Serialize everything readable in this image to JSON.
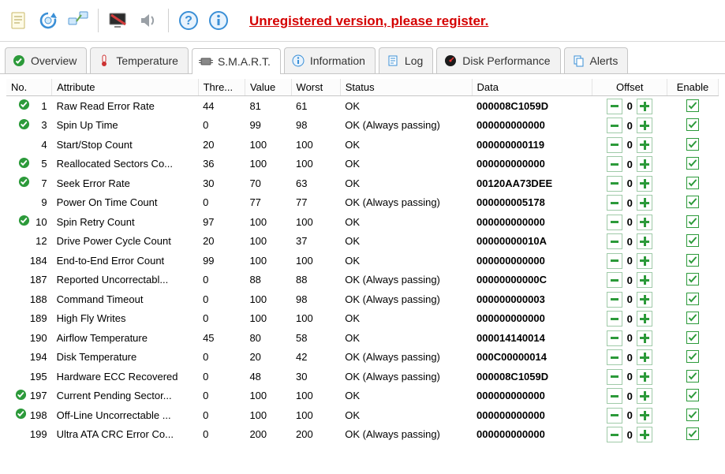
{
  "header": {
    "unregistered_text": "Unregistered version, please register."
  },
  "tabs": [
    {
      "label": "Overview"
    },
    {
      "label": "Temperature"
    },
    {
      "label": "S.M.A.R.T."
    },
    {
      "label": "Information"
    },
    {
      "label": "Log"
    },
    {
      "label": "Disk Performance"
    },
    {
      "label": "Alerts"
    }
  ],
  "columns": {
    "no": "No.",
    "attribute": "Attribute",
    "threshold": "Thre...",
    "value": "Value",
    "worst": "Worst",
    "status": "Status",
    "data": "Data",
    "offset": "Offset",
    "enable": "Enable"
  },
  "rows": [
    {
      "hasIcon": true,
      "no": "1",
      "attribute": "Raw Read Error Rate",
      "threshold": "44",
      "value": "81",
      "worst": "61",
      "status": "OK",
      "data": "000008C1059D",
      "offset": "0",
      "enable": true
    },
    {
      "hasIcon": true,
      "no": "3",
      "attribute": "Spin Up Time",
      "threshold": "0",
      "value": "99",
      "worst": "98",
      "status": "OK (Always passing)",
      "data": "000000000000",
      "offset": "0",
      "enable": true
    },
    {
      "hasIcon": false,
      "no": "4",
      "attribute": "Start/Stop Count",
      "threshold": "20",
      "value": "100",
      "worst": "100",
      "status": "OK",
      "data": "000000000119",
      "offset": "0",
      "enable": true
    },
    {
      "hasIcon": true,
      "no": "5",
      "attribute": "Reallocated Sectors Co...",
      "threshold": "36",
      "value": "100",
      "worst": "100",
      "status": "OK",
      "data": "000000000000",
      "offset": "0",
      "enable": true
    },
    {
      "hasIcon": true,
      "no": "7",
      "attribute": "Seek Error Rate",
      "threshold": "30",
      "value": "70",
      "worst": "63",
      "status": "OK",
      "data": "00120AA73DEE",
      "offset": "0",
      "enable": true
    },
    {
      "hasIcon": false,
      "no": "9",
      "attribute": "Power On Time Count",
      "threshold": "0",
      "value": "77",
      "worst": "77",
      "status": "OK (Always passing)",
      "data": "000000005178",
      "offset": "0",
      "enable": true
    },
    {
      "hasIcon": true,
      "no": "10",
      "attribute": "Spin Retry Count",
      "threshold": "97",
      "value": "100",
      "worst": "100",
      "status": "OK",
      "data": "000000000000",
      "offset": "0",
      "enable": true
    },
    {
      "hasIcon": false,
      "no": "12",
      "attribute": "Drive Power Cycle Count",
      "threshold": "20",
      "value": "100",
      "worst": "37",
      "status": "OK",
      "data": "00000000010A",
      "offset": "0",
      "enable": true
    },
    {
      "hasIcon": false,
      "no": "184",
      "attribute": "End-to-End Error Count",
      "threshold": "99",
      "value": "100",
      "worst": "100",
      "status": "OK",
      "data": "000000000000",
      "offset": "0",
      "enable": true
    },
    {
      "hasIcon": false,
      "no": "187",
      "attribute": "Reported Uncorrectabl...",
      "threshold": "0",
      "value": "88",
      "worst": "88",
      "status": "OK (Always passing)",
      "data": "00000000000C",
      "offset": "0",
      "enable": true
    },
    {
      "hasIcon": false,
      "no": "188",
      "attribute": "Command Timeout",
      "threshold": "0",
      "value": "100",
      "worst": "98",
      "status": "OK (Always passing)",
      "data": "000000000003",
      "offset": "0",
      "enable": true
    },
    {
      "hasIcon": false,
      "no": "189",
      "attribute": "High Fly Writes",
      "threshold": "0",
      "value": "100",
      "worst": "100",
      "status": "OK",
      "data": "000000000000",
      "offset": "0",
      "enable": true
    },
    {
      "hasIcon": false,
      "no": "190",
      "attribute": "Airflow Temperature",
      "threshold": "45",
      "value": "80",
      "worst": "58",
      "status": "OK",
      "data": "000014140014",
      "offset": "0",
      "enable": true
    },
    {
      "hasIcon": false,
      "no": "194",
      "attribute": "Disk Temperature",
      "threshold": "0",
      "value": "20",
      "worst": "42",
      "status": "OK (Always passing)",
      "data": "000C00000014",
      "offset": "0",
      "enable": true
    },
    {
      "hasIcon": false,
      "no": "195",
      "attribute": "Hardware ECC Recovered",
      "threshold": "0",
      "value": "48",
      "worst": "30",
      "status": "OK (Always passing)",
      "data": "000008C1059D",
      "offset": "0",
      "enable": true
    },
    {
      "hasIcon": true,
      "no": "197",
      "attribute": "Current Pending Sector...",
      "threshold": "0",
      "value": "100",
      "worst": "100",
      "status": "OK",
      "data": "000000000000",
      "offset": "0",
      "enable": true
    },
    {
      "hasIcon": true,
      "no": "198",
      "attribute": "Off-Line Uncorrectable ...",
      "threshold": "0",
      "value": "100",
      "worst": "100",
      "status": "OK",
      "data": "000000000000",
      "offset": "0",
      "enable": true
    },
    {
      "hasIcon": false,
      "no": "199",
      "attribute": "Ultra ATA CRC Error Co...",
      "threshold": "0",
      "value": "200",
      "worst": "200",
      "status": "OK (Always passing)",
      "data": "000000000000",
      "offset": "0",
      "enable": true
    }
  ]
}
